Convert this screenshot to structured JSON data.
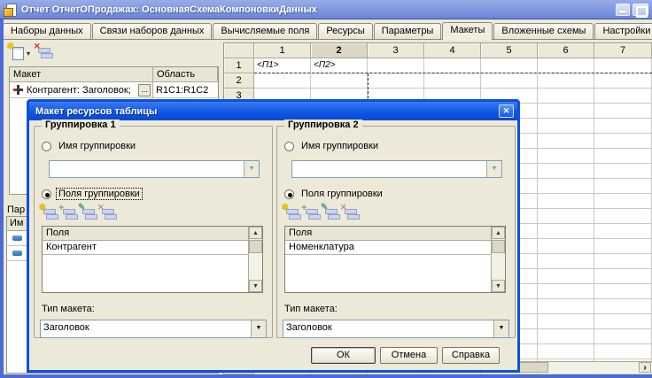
{
  "window": {
    "title": "Отчет ОтчетОПродажах: ОсновнаяСхемаКомпоновкиДанных"
  },
  "tabs": {
    "active": "Макеты",
    "items": [
      "Наборы данных",
      "Связи наборов данных",
      "Вычисляемые поля",
      "Ресурсы",
      "Параметры",
      "Макеты",
      "Вложенные схемы",
      "Настройки"
    ]
  },
  "left_panel": {
    "table": {
      "col_template": "Макет",
      "col_area": "Область",
      "row": {
        "template": "Контрагент: Заголовок;",
        "more": "...",
        "area": "R1C1:R1C2"
      }
    },
    "params": {
      "title": "Пар",
      "column": "Им"
    }
  },
  "grid": {
    "columns": [
      "1",
      "2",
      "3",
      "4",
      "5",
      "6",
      "7"
    ],
    "selected_column": "2",
    "row_count": 21,
    "cells": {
      "r1c1": "<П1>",
      "r1c2": "<П2>"
    }
  },
  "dialog": {
    "title": "Макет ресурсов таблицы",
    "groups": [
      {
        "legend": "Группировка 1",
        "name_radio": "Имя группировки",
        "name_selected": false,
        "fields_radio": "Поля группировки",
        "fields_selected": true,
        "fields_focused": true,
        "list_header": "Поля",
        "items": [
          "Контрагент"
        ],
        "type_label": "Тип макета:",
        "type_value": "Заголовок"
      },
      {
        "legend": "Группировка 2",
        "name_radio": "Имя группировки",
        "name_selected": false,
        "fields_radio": "Поля группировки",
        "fields_selected": true,
        "fields_focused": false,
        "list_header": "Поля",
        "items": [
          "Номенклатура"
        ],
        "type_label": "Тип макета:",
        "type_value": "Заголовок"
      }
    ],
    "buttons": [
      "ОК",
      "Отмена",
      "Справка"
    ]
  },
  "icons": {
    "close": "✕",
    "star": "✱",
    "plus": "+",
    "pencil": "✎",
    "cross": "✕",
    "caret_down": "▾",
    "arrow_down": "▼",
    "arrow_up": "▲",
    "chevron_right": "›"
  },
  "colors": {
    "accent": "#0d52d8",
    "titlebar": "#7e97e0",
    "window_bg": "#ece9d8"
  }
}
